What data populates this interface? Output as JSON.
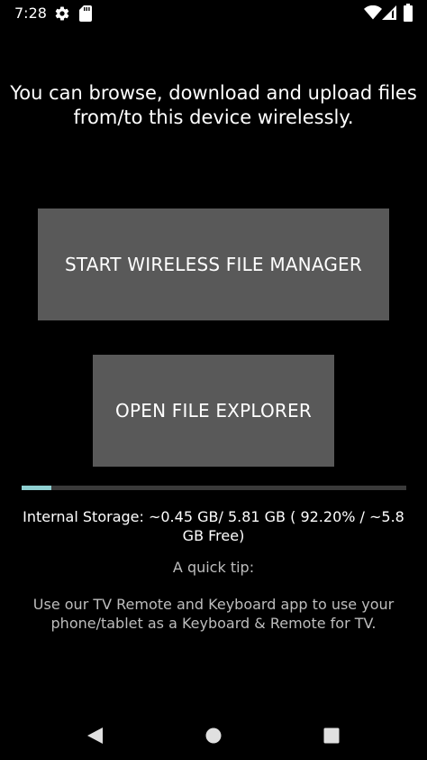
{
  "status_bar": {
    "time": "7:28",
    "icons": [
      "gear-icon",
      "sd-card-icon",
      "wifi-icon",
      "signal-icon",
      "battery-icon"
    ]
  },
  "main": {
    "intro_text": "You can browse, download and upload files from/to this device wirelessly.",
    "start_button_label": "START WIRELESS FILE MANAGER",
    "explorer_button_label": "OPEN FILE EXPLORER",
    "storage": {
      "progress_fraction": 0.078,
      "text": "Internal Storage: ~0.45 GB/ 5.81 GB ( 92.20% / ~5.8 GB Free)"
    },
    "tip_title": "A quick tip:",
    "tip_body": "Use our TV Remote and Keyboard app to use your phone/tablet as a Keyboard & Remote for TV."
  },
  "nav_bar": {
    "icons": [
      "back-icon",
      "home-icon",
      "recents-icon"
    ]
  },
  "colors": {
    "background": "#000000",
    "button": "#595959",
    "progress_fill": "#8ecfd1",
    "progress_track": "#3a3a3a",
    "secondary_text": "#bdbdbd"
  }
}
